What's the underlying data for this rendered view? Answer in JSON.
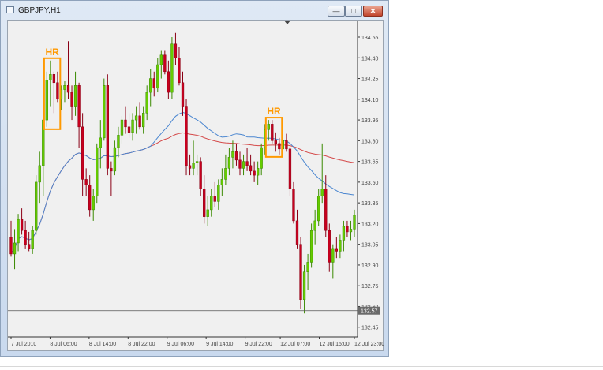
{
  "window": {
    "title": "GBPJPY,H1"
  },
  "colors": {
    "bull": "#66cc00",
    "bear": "#c8001e",
    "ma_red": "#d44848",
    "ma_blue": "#4a86d0",
    "hr": "#ff9900",
    "price_tag": "#6b6b6b"
  },
  "chart_data": {
    "type": "candlestick",
    "title": "GBPJPY,H1",
    "symbol": "GBPJPY",
    "timeframe": "H1",
    "ylim": [
      132.38,
      134.67
    ],
    "y_ticks": [
      "134.55",
      "134.40",
      "134.25",
      "134.10",
      "133.95",
      "133.80",
      "133.65",
      "133.50",
      "133.35",
      "133.20",
      "133.05",
      "132.90",
      "132.75",
      "132.60",
      "132.45"
    ],
    "x_ticks": [
      "7 Jul 2010",
      "8 Jul 06:00",
      "8 Jul 14:00",
      "8 Jul 22:00",
      "9 Jul 06:00",
      "9 Jul 14:00",
      "9 Jul 22:00",
      "12 Jul 07:00",
      "12 Jul 15:00",
      "12 Jul 23:00"
    ],
    "current_price": "132.57",
    "annotations": [
      {
        "text": "HR",
        "from": 10,
        "to": 13
      },
      {
        "text": "HR",
        "from": 72,
        "to": 75
      }
    ],
    "candles": [
      [
        133.1,
        133.22,
        132.96,
        132.98
      ],
      [
        132.98,
        133.16,
        132.87,
        133.06
      ],
      [
        133.06,
        133.27,
        133.0,
        133.23
      ],
      [
        133.23,
        133.31,
        133.12,
        133.15
      ],
      [
        133.15,
        133.22,
        133.02,
        133.05
      ],
      [
        133.05,
        133.14,
        133.0,
        133.02
      ],
      [
        133.02,
        133.18,
        132.98,
        133.15
      ],
      [
        133.15,
        133.55,
        133.12,
        133.5
      ],
      [
        133.5,
        133.72,
        133.35,
        133.62
      ],
      [
        133.62,
        134.05,
        133.4,
        133.95
      ],
      [
        133.95,
        134.3,
        133.9,
        134.24
      ],
      [
        134.24,
        134.38,
        134.05,
        134.28
      ],
      [
        134.28,
        134.3,
        134.0,
        134.22
      ],
      [
        134.22,
        134.3,
        134.08,
        134.1
      ],
      [
        134.1,
        134.2,
        134.02,
        134.17
      ],
      [
        134.17,
        134.23,
        134.08,
        134.2
      ],
      [
        134.2,
        134.52,
        134.1,
        134.15
      ],
      [
        134.15,
        134.2,
        133.95,
        134.05
      ],
      [
        134.05,
        134.3,
        133.98,
        134.2
      ],
      [
        134.2,
        134.22,
        133.75,
        133.9
      ],
      [
        133.9,
        134.0,
        133.4,
        133.52
      ],
      [
        133.52,
        133.6,
        133.4,
        133.48
      ],
      [
        133.48,
        133.55,
        133.25,
        133.3
      ],
      [
        133.3,
        133.45,
        133.22,
        133.4
      ],
      [
        133.4,
        133.78,
        133.35,
        133.75
      ],
      [
        133.75,
        133.95,
        133.6,
        133.82
      ],
      [
        133.82,
        134.25,
        133.8,
        134.2
      ],
      [
        134.2,
        134.28,
        133.55,
        133.6
      ],
      [
        133.6,
        133.65,
        133.4,
        133.58
      ],
      [
        133.58,
        133.8,
        133.55,
        133.75
      ],
      [
        133.75,
        133.9,
        133.68,
        133.84
      ],
      [
        133.84,
        133.98,
        133.78,
        133.95
      ],
      [
        133.95,
        134.05,
        133.85,
        133.9
      ],
      [
        133.9,
        134.0,
        133.82,
        133.86
      ],
      [
        133.86,
        134.0,
        133.8,
        133.95
      ],
      [
        133.95,
        134.05,
        133.85,
        133.98
      ],
      [
        133.98,
        134.08,
        133.88,
        133.9
      ],
      [
        133.9,
        134.05,
        133.85,
        134.0
      ],
      [
        134.0,
        134.2,
        133.95,
        134.15
      ],
      [
        134.15,
        134.32,
        134.05,
        134.25
      ],
      [
        134.25,
        134.3,
        134.12,
        134.18
      ],
      [
        134.18,
        134.4,
        134.15,
        134.35
      ],
      [
        134.35,
        134.45,
        134.25,
        134.42
      ],
      [
        134.42,
        134.45,
        134.28,
        134.3
      ],
      [
        134.3,
        134.38,
        134.1,
        134.15
      ],
      [
        134.15,
        134.55,
        134.1,
        134.5
      ],
      [
        134.5,
        134.58,
        134.35,
        134.4
      ],
      [
        134.4,
        134.48,
        134.2,
        134.22
      ],
      [
        134.22,
        134.3,
        133.98,
        134.05
      ],
      [
        134.05,
        134.1,
        133.55,
        133.62
      ],
      [
        133.62,
        133.7,
        133.55,
        133.6
      ],
      [
        133.6,
        133.8,
        133.55,
        133.64
      ],
      [
        133.64,
        133.7,
        133.55,
        133.65
      ],
      [
        133.65,
        133.68,
        133.4,
        133.45
      ],
      [
        133.45,
        133.55,
        133.2,
        133.25
      ],
      [
        133.25,
        133.4,
        133.18,
        133.3
      ],
      [
        133.3,
        133.45,
        133.25,
        133.4
      ],
      [
        133.4,
        133.5,
        133.32,
        133.36
      ],
      [
        133.36,
        133.52,
        133.3,
        133.48
      ],
      [
        133.48,
        133.6,
        133.4,
        133.52
      ],
      [
        133.52,
        133.7,
        133.48,
        133.6
      ],
      [
        133.6,
        133.75,
        133.55,
        133.68
      ],
      [
        133.68,
        133.8,
        133.6,
        133.72
      ],
      [
        133.72,
        133.78,
        133.62,
        133.66
      ],
      [
        133.66,
        133.72,
        133.55,
        133.6
      ],
      [
        133.6,
        133.7,
        133.55,
        133.65
      ],
      [
        133.65,
        133.75,
        133.58,
        133.62
      ],
      [
        133.62,
        133.7,
        133.55,
        133.58
      ],
      [
        133.58,
        133.65,
        133.5,
        133.55
      ],
      [
        133.55,
        133.65,
        133.48,
        133.6
      ],
      [
        133.6,
        133.78,
        133.55,
        133.75
      ],
      [
        133.75,
        133.92,
        133.7,
        133.88
      ],
      [
        133.88,
        133.95,
        133.8,
        133.92
      ],
      [
        133.92,
        133.95,
        133.78,
        133.8
      ],
      [
        133.8,
        133.86,
        133.72,
        133.78
      ],
      [
        133.78,
        133.82,
        133.7,
        133.74
      ],
      [
        133.74,
        133.84,
        133.68,
        133.8
      ],
      [
        133.8,
        133.85,
        133.72,
        133.74
      ],
      [
        133.74,
        133.76,
        133.4,
        133.45
      ],
      [
        133.45,
        133.5,
        133.2,
        133.22
      ],
      [
        133.22,
        133.3,
        133.02,
        133.05
      ],
      [
        133.05,
        133.1,
        132.58,
        132.65
      ],
      [
        132.65,
        132.9,
        132.55,
        132.85
      ],
      [
        132.85,
        132.98,
        132.72,
        132.92
      ],
      [
        132.92,
        133.2,
        132.88,
        133.15
      ],
      [
        133.15,
        133.3,
        133.05,
        133.22
      ],
      [
        133.22,
        133.45,
        133.18,
        133.4
      ],
      [
        133.4,
        133.78,
        133.35,
        133.45
      ],
      [
        133.45,
        133.55,
        133.1,
        133.15
      ],
      [
        133.15,
        133.2,
        132.85,
        132.92
      ],
      [
        132.92,
        133.05,
        132.8,
        133.02
      ],
      [
        133.02,
        133.1,
        132.95,
        133.0
      ],
      [
        133.0,
        133.12,
        132.95,
        133.08
      ],
      [
        133.08,
        133.22,
        133.0,
        133.18
      ],
      [
        133.18,
        133.22,
        133.1,
        133.14
      ],
      [
        133.14,
        133.22,
        133.08,
        133.16
      ],
      [
        133.16,
        133.3,
        133.1,
        133.26
      ]
    ]
  }
}
